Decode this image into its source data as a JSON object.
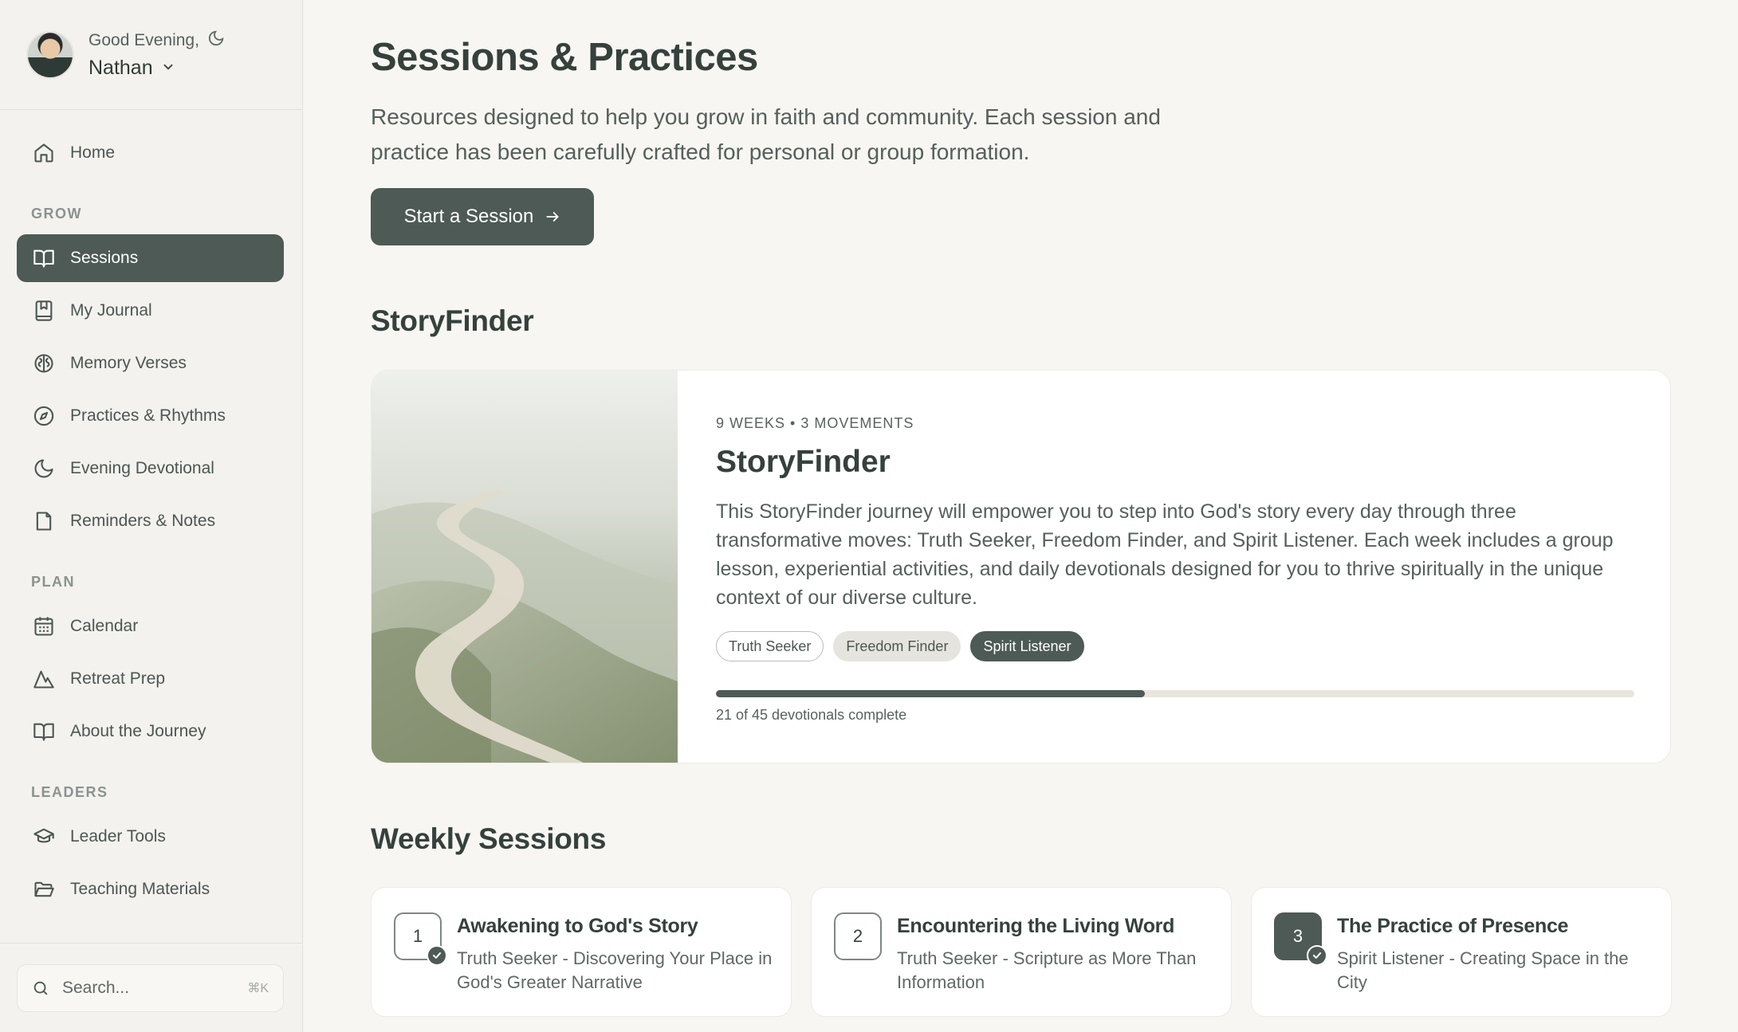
{
  "profile": {
    "greeting": "Good Evening,",
    "name": "Nathan"
  },
  "nav": {
    "home": "Home",
    "sections": {
      "grow": "GROW",
      "plan": "PLAN",
      "leaders": "LEADERS"
    },
    "grow_items": [
      {
        "label": "Sessions",
        "icon": "book-open-icon",
        "active": true
      },
      {
        "label": "My Journal",
        "icon": "journal-icon"
      },
      {
        "label": "Memory Verses",
        "icon": "brain-icon"
      },
      {
        "label": "Practices & Rhythms",
        "icon": "compass-icon"
      },
      {
        "label": "Evening Devotional",
        "icon": "moon-icon"
      },
      {
        "label": "Reminders & Notes",
        "icon": "note-icon"
      }
    ],
    "plan_items": [
      {
        "label": "Calendar",
        "icon": "calendar-icon"
      },
      {
        "label": "Retreat Prep",
        "icon": "mountain-icon"
      },
      {
        "label": "About the Journey",
        "icon": "book-open-icon"
      }
    ],
    "leader_items": [
      {
        "label": "Leader Tools",
        "icon": "graduation-cap-icon"
      },
      {
        "label": "Teaching Materials",
        "icon": "folder-open-icon"
      }
    ]
  },
  "search": {
    "placeholder": "Search...",
    "shortcut": "⌘K"
  },
  "header": {
    "title": "Sessions & Practices",
    "intro": "Resources designed to help you grow in faith and community. Each session and practice has been carefully crafted for personal or group formation.",
    "cta": "Start a Session"
  },
  "storyfinder": {
    "section_title": "StoryFinder",
    "meta": "9 WEEKS • 3 MOVEMENTS",
    "title": "StoryFinder",
    "description": "This StoryFinder journey will empower you to step into God's story every day through three transformative moves: Truth Seeker, Freedom Finder, and Spirit Listener. Each week includes a group lesson, experiential activities, and daily devotionals designed for you to thrive spiritually in the unique context of our diverse culture.",
    "tags": [
      "Truth Seeker",
      "Freedom Finder",
      "Spirit Listener"
    ],
    "progress_done": 21,
    "progress_total": 45,
    "progress_label": "21 of 45 devotionals complete"
  },
  "weekly": {
    "section_title": "Weekly Sessions",
    "sessions": [
      {
        "number": "1",
        "title": "Awakening to God's Story",
        "subtitle": "Truth Seeker - Discovering Your Place in God's Greater Narrative",
        "completed": true
      },
      {
        "number": "2",
        "title": "Encountering the Living Word",
        "subtitle": "Truth Seeker - Scripture as More Than Information",
        "completed": false
      },
      {
        "number": "3",
        "title": "The Practice of Presence",
        "subtitle": "Spirit Listener - Creating Space in the City",
        "completed": true
      }
    ]
  },
  "colors": {
    "accent": "#4d5a55",
    "background": "#f7f6f3",
    "sidebar": "#f3f2ef"
  }
}
